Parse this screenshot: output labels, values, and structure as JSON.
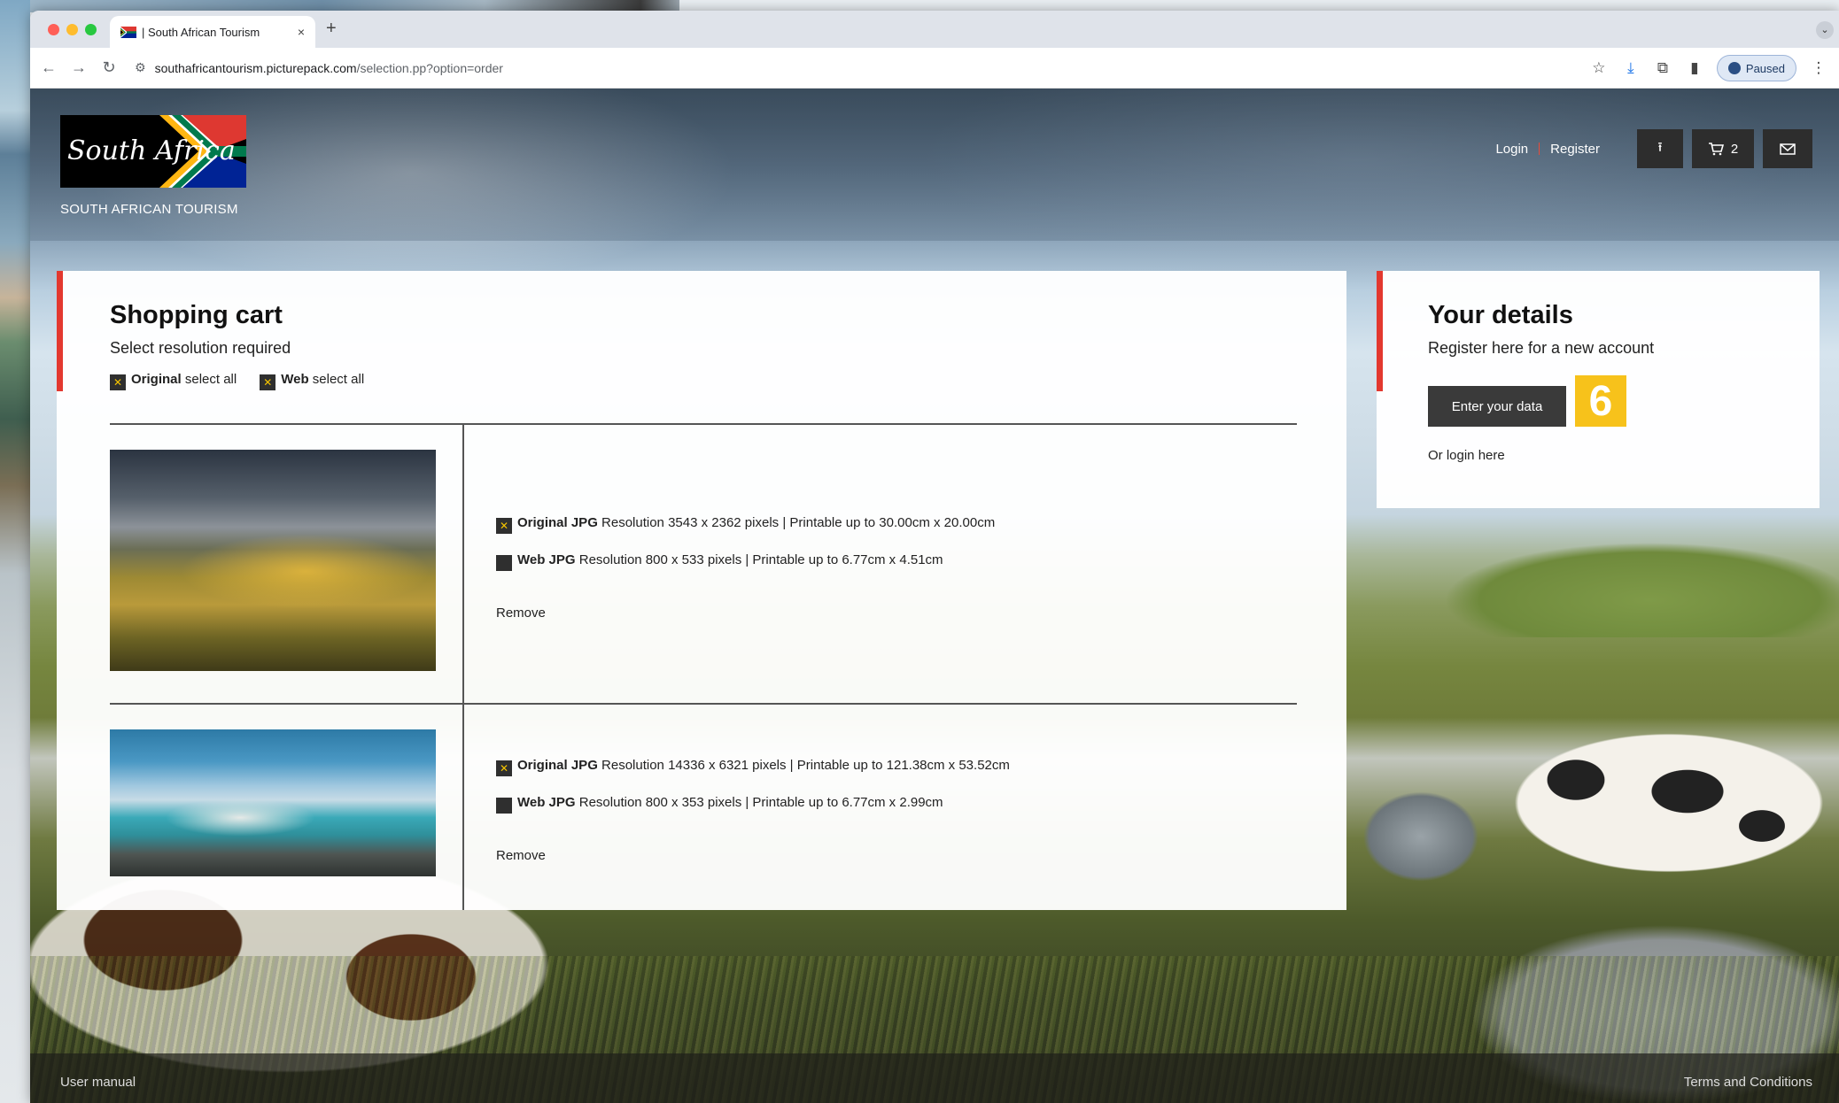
{
  "browser": {
    "tab_title": "| South African Tourism",
    "tab_close": "×",
    "new_tab": "+",
    "url_host": "southafricantourism.picturepack.com",
    "url_path": "/selection.pp?option=order",
    "profile_label": "Paused"
  },
  "header": {
    "logo_text": "South Africa",
    "logo_caption": "SOUTH AFRICAN TOURISM",
    "login": "Login",
    "register": "Register",
    "cart_count": "2"
  },
  "cart": {
    "title": "Shopping cart",
    "subtitle": "Select resolution required",
    "select_all": [
      {
        "bold": "Original",
        "rest": " select all",
        "checked": true
      },
      {
        "bold": "Web",
        "rest": " select all",
        "checked": true
      }
    ],
    "items": [
      {
        "options": [
          {
            "bold": "Original JPG",
            "detail": " Resolution  3543 x 2362 pixels  | Printable up to 30.00cm x 20.00cm",
            "checked": true
          },
          {
            "bold": "Web JPG",
            "detail": " Resolution  800 x 533 pixels  | Printable up to 6.77cm x 4.51cm",
            "checked": false
          }
        ],
        "remove": "Remove"
      },
      {
        "options": [
          {
            "bold": "Original JPG",
            "detail": " Resolution  14336 x 6321 pixels  | Printable up to 121.38cm x 53.52cm",
            "checked": true
          },
          {
            "bold": "Web JPG",
            "detail": " Resolution  800 x 353 pixels  | Printable up to 6.77cm x 2.99cm",
            "checked": false
          }
        ],
        "remove": "Remove"
      }
    ]
  },
  "details": {
    "title": "Your details",
    "subtitle": "Register here for a new account",
    "button": "Enter your data",
    "step": "6",
    "or_login": "Or login here"
  },
  "footer": {
    "left": "User manual",
    "right": "Terms and Conditions"
  },
  "colors": {
    "accent_red": "#e3382f",
    "badge_yellow": "#f7c21b",
    "dark_button": "#3a3a3a"
  }
}
